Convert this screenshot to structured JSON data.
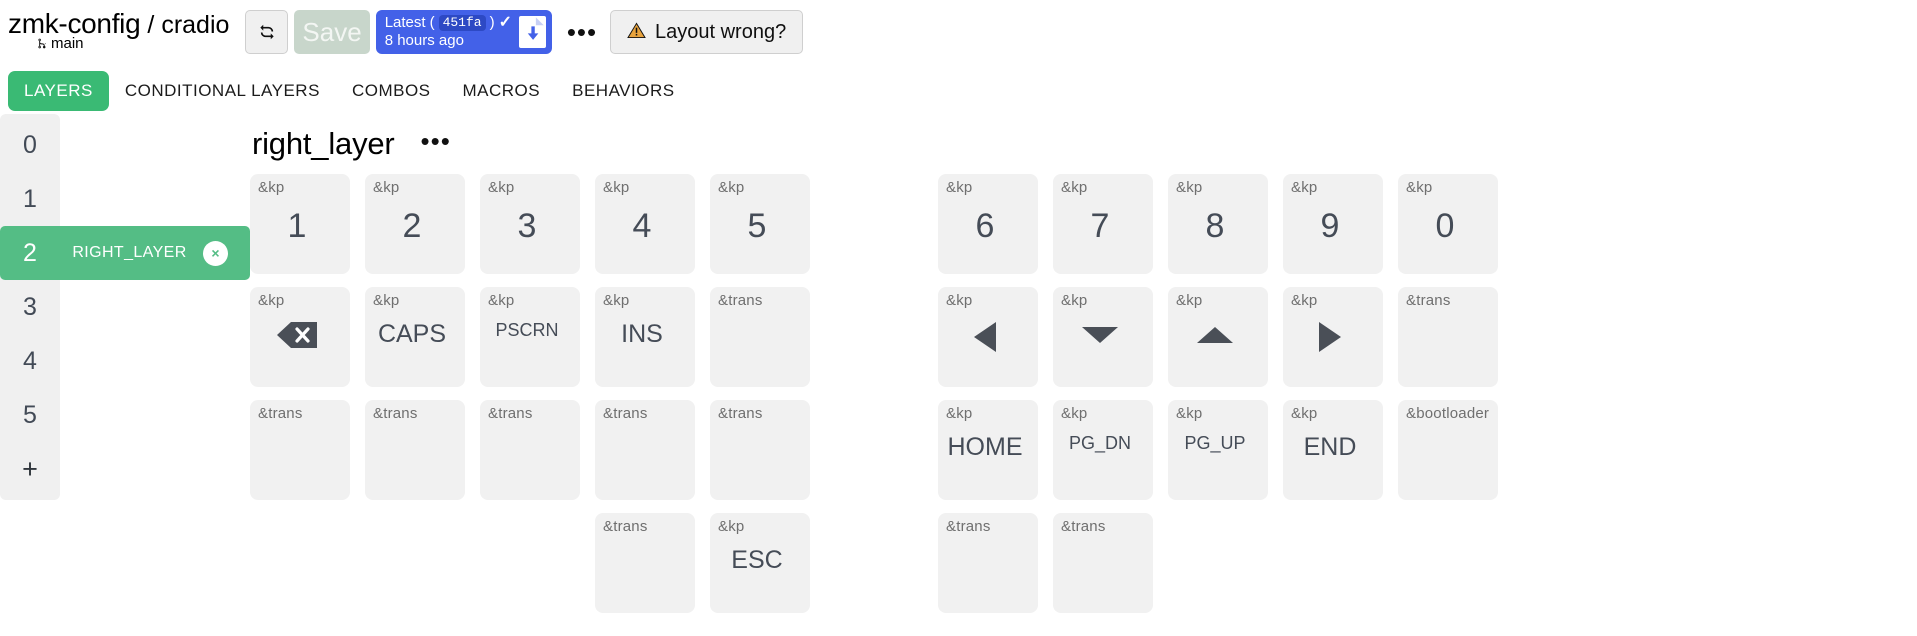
{
  "header": {
    "repo_name": "zmk-config",
    "separator": "/",
    "keyboard_name": "cradio",
    "branch": "main",
    "refresh_label": "refresh-icon",
    "save_label": "Save",
    "commit": {
      "prefix": "Latest",
      "open_paren": "(",
      "hash": "451fa",
      "close_paren": ")",
      "check": "✓",
      "time": "8 hours ago"
    },
    "more_label": "•••",
    "layout_warn_icon": "⚠",
    "layout_label": "Layout wrong?"
  },
  "tabs": [
    {
      "label": "LAYERS",
      "active": true
    },
    {
      "label": "CONDITIONAL LAYERS",
      "active": false
    },
    {
      "label": "COMBOS",
      "active": false
    },
    {
      "label": "MACROS",
      "active": false
    },
    {
      "label": "BEHAVIORS",
      "active": false
    }
  ],
  "layers": {
    "items": [
      {
        "num": "0",
        "name": "",
        "selected": false
      },
      {
        "num": "1",
        "name": "",
        "selected": false
      },
      {
        "num": "2",
        "name": "RIGHT_LAYER",
        "selected": true,
        "close": "×"
      },
      {
        "num": "3",
        "name": "",
        "selected": false
      },
      {
        "num": "4",
        "name": "",
        "selected": false
      },
      {
        "num": "5",
        "name": "",
        "selected": false
      }
    ],
    "add_label": "+"
  },
  "keymap": {
    "title": "right_layer",
    "menu_label": "•••",
    "keys": [
      {
        "behavior": "&kp",
        "code": "1",
        "size": "big",
        "col": 0,
        "row": 0,
        "half": "left"
      },
      {
        "behavior": "&kp",
        "code": "2",
        "size": "big",
        "col": 1,
        "row": 0,
        "half": "left"
      },
      {
        "behavior": "&kp",
        "code": "3",
        "size": "big",
        "col": 2,
        "row": 0,
        "half": "left"
      },
      {
        "behavior": "&kp",
        "code": "4",
        "size": "big",
        "col": 3,
        "row": 0,
        "half": "left"
      },
      {
        "behavior": "&kp",
        "code": "5",
        "size": "big",
        "col": 4,
        "row": 0,
        "half": "left"
      },
      {
        "behavior": "&kp",
        "code": "6",
        "size": "big",
        "col": 0,
        "row": 0,
        "half": "right"
      },
      {
        "behavior": "&kp",
        "code": "7",
        "size": "big",
        "col": 1,
        "row": 0,
        "half": "right"
      },
      {
        "behavior": "&kp",
        "code": "8",
        "size": "big",
        "col": 2,
        "row": 0,
        "half": "right"
      },
      {
        "behavior": "&kp",
        "code": "9",
        "size": "big",
        "col": 3,
        "row": 0,
        "half": "right"
      },
      {
        "behavior": "&kp",
        "code": "0",
        "size": "big",
        "col": 4,
        "row": 0,
        "half": "right"
      },
      {
        "behavior": "&kp",
        "icon": "delete-icon",
        "code": "",
        "size": "med",
        "col": 0,
        "row": 1,
        "half": "left"
      },
      {
        "behavior": "&kp",
        "code": "CAPS",
        "size": "med",
        "col": 1,
        "row": 1,
        "half": "left"
      },
      {
        "behavior": "&kp",
        "code": "PSCRN",
        "size": "sm",
        "col": 2,
        "row": 1,
        "half": "left"
      },
      {
        "behavior": "&kp",
        "code": "INS",
        "size": "med",
        "col": 3,
        "row": 1,
        "half": "left"
      },
      {
        "behavior": "&trans",
        "code": "",
        "size": "med",
        "col": 4,
        "row": 1,
        "half": "left"
      },
      {
        "behavior": "&kp",
        "icon": "arrow-left-icon",
        "code": "",
        "size": "med",
        "col": 0,
        "row": 1,
        "half": "right"
      },
      {
        "behavior": "&kp",
        "icon": "arrow-down-icon",
        "code": "",
        "size": "med",
        "col": 1,
        "row": 1,
        "half": "right"
      },
      {
        "behavior": "&kp",
        "icon": "arrow-up-icon",
        "code": "",
        "size": "med",
        "col": 2,
        "row": 1,
        "half": "right"
      },
      {
        "behavior": "&kp",
        "icon": "arrow-right-icon",
        "code": "",
        "size": "med",
        "col": 3,
        "row": 1,
        "half": "right"
      },
      {
        "behavior": "&trans",
        "code": "",
        "size": "med",
        "col": 4,
        "row": 1,
        "half": "right"
      },
      {
        "behavior": "&trans",
        "code": "",
        "size": "med",
        "col": 0,
        "row": 2,
        "half": "left"
      },
      {
        "behavior": "&trans",
        "code": "",
        "size": "med",
        "col": 1,
        "row": 2,
        "half": "left"
      },
      {
        "behavior": "&trans",
        "code": "",
        "size": "med",
        "col": 2,
        "row": 2,
        "half": "left"
      },
      {
        "behavior": "&trans",
        "code": "",
        "size": "med",
        "col": 3,
        "row": 2,
        "half": "left"
      },
      {
        "behavior": "&trans",
        "code": "",
        "size": "med",
        "col": 4,
        "row": 2,
        "half": "left"
      },
      {
        "behavior": "&kp",
        "code": "HOME",
        "size": "med",
        "col": 0,
        "row": 2,
        "half": "right"
      },
      {
        "behavior": "&kp",
        "code": "PG_DN",
        "size": "sm",
        "col": 1,
        "row": 2,
        "half": "right"
      },
      {
        "behavior": "&kp",
        "code": "PG_UP",
        "size": "sm",
        "col": 2,
        "row": 2,
        "half": "right"
      },
      {
        "behavior": "&kp",
        "code": "END",
        "size": "med",
        "col": 3,
        "row": 2,
        "half": "right"
      },
      {
        "behavior": "&bootloader",
        "code": "",
        "size": "med",
        "col": 4,
        "row": 2,
        "half": "right"
      },
      {
        "behavior": "&trans",
        "code": "",
        "size": "med",
        "col": 3,
        "row": 3,
        "half": "left"
      },
      {
        "behavior": "&kp",
        "code": "ESC",
        "size": "med",
        "col": 4,
        "row": 3,
        "half": "left"
      },
      {
        "behavior": "&trans",
        "code": "",
        "size": "med",
        "col": 0,
        "row": 3,
        "half": "right"
      },
      {
        "behavior": "&trans",
        "code": "",
        "size": "med",
        "col": 1,
        "row": 3,
        "half": "right"
      }
    ]
  },
  "colors": {
    "accent_green": "#3aba74",
    "layer_green": "#54bd85",
    "commit_blue": "#4361e8",
    "key_bg": "#f1f1f1"
  }
}
